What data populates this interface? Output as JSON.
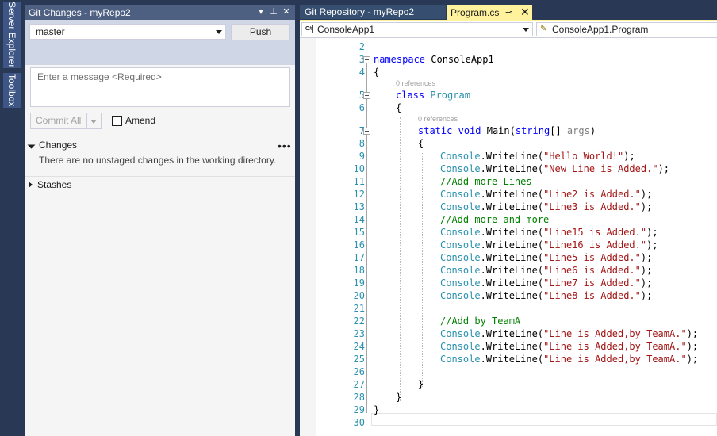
{
  "side_rail": {
    "tabs": [
      {
        "label": "Server Explorer"
      },
      {
        "label": "Toolbox"
      }
    ]
  },
  "git_changes": {
    "title": "Git Changes - myRepo2",
    "branch": "master",
    "push_label": "Push",
    "message_placeholder": "Enter a message <Required>",
    "commit_label": "Commit All",
    "amend_label": "Amend",
    "changes_header": "Changes",
    "changes_more": "•••",
    "changes_empty": "There are no unstaged changes in the working directory.",
    "stashes_header": "Stashes",
    "title_controls": {
      "dropdown": "▾",
      "pin": "⊥",
      "close": "✕"
    }
  },
  "tabs": {
    "repo": "Git Repository - myRepo2",
    "program": "Program.cs",
    "program_pin": "⊸",
    "program_close": "✕"
  },
  "editor": {
    "project": "ConsoleApp1",
    "project_icon": "C#",
    "class_path": "ConsoleApp1.Program",
    "class_icon": "✎",
    "references": "0 references",
    "line_numbers": [
      "2",
      "3",
      "4",
      "5",
      "6",
      "7",
      "8",
      "9",
      "10",
      "11",
      "12",
      "13",
      "14",
      "15",
      "16",
      "17",
      "18",
      "19",
      "20",
      "21",
      "22",
      "23",
      "24",
      "25",
      "26",
      "27",
      "28",
      "29",
      "30"
    ],
    "code": {
      "l3_kw": "namespace",
      "l3_name": " ConsoleApp1",
      "open_brace": "{",
      "close_brace": "}",
      "l5_kw": "class",
      "l5_type": "Program",
      "l7_static": "static",
      "l7_void": "void",
      "l7_main": " Main(",
      "l7_string": "string",
      "l7_rest": "[] ",
      "l7_args": "args",
      "l7_end": ")",
      "console": "Console",
      "writeline": ".WriteLine(",
      "end": ");",
      "s9": "\"Hello World!\"",
      "s10": "\"New Line is Added.\"",
      "c11": "//Add more Lines",
      "s12": "\"Line2 is Added.\"",
      "s13": "\"Line3 is Added.\"",
      "c14": "//Add more and more",
      "s15": "\"Line15 is Added.\"",
      "s16": "\"Line16 is Added.\"",
      "s17": "\"Line5 is Added.\"",
      "s18": "\"Line6 is Added.\"",
      "s19": "\"Line7 is Added.\"",
      "s20": "\"Line8 is Added.\"",
      "c22": "//Add by TeamA",
      "s23": "\"Line is Added,by TeamA.\"",
      "s24": "\"Line is Added,by TeamA.\"",
      "s25": "\"Line is Added,by TeamA.\""
    }
  }
}
